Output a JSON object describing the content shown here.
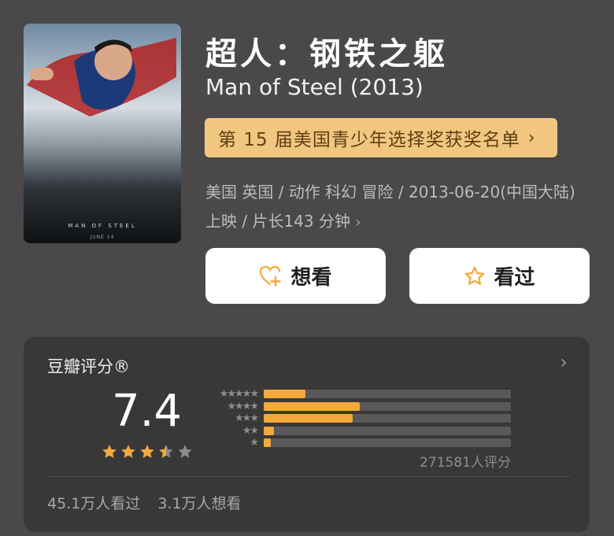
{
  "movie": {
    "title_cn": "超人：钢铁之躯",
    "title_en": "Man of Steel (2013)",
    "poster": {
      "title": "MAN OF STEEL",
      "date": "JUNE 14"
    },
    "award_label": "第 15 届美国青少年选择奖获奖名单",
    "meta_line": "美国 英国 / 动作 科幻 冒险 / 2013-06-20(中国大陆) 上映 / 片长143 分钟"
  },
  "actions": {
    "want_label": "想看",
    "seen_label": "看过"
  },
  "rating": {
    "section_title": "豆瓣评分®",
    "score": "7.4",
    "score_stars_out_of_5": 3.7,
    "distribution_percent": {
      "5": 17,
      "4": 39,
      "3": 36,
      "2": 4,
      "1": 3
    },
    "count_label": "271581人评分"
  },
  "stats": {
    "seen": "45.1万人看过",
    "want": "3.1万人想看"
  },
  "colors": {
    "background": "#4a4848",
    "card": "#393838",
    "accent_star": "#f4a93c",
    "award_bg": "#f3c680",
    "award_text": "#5d3f12"
  }
}
